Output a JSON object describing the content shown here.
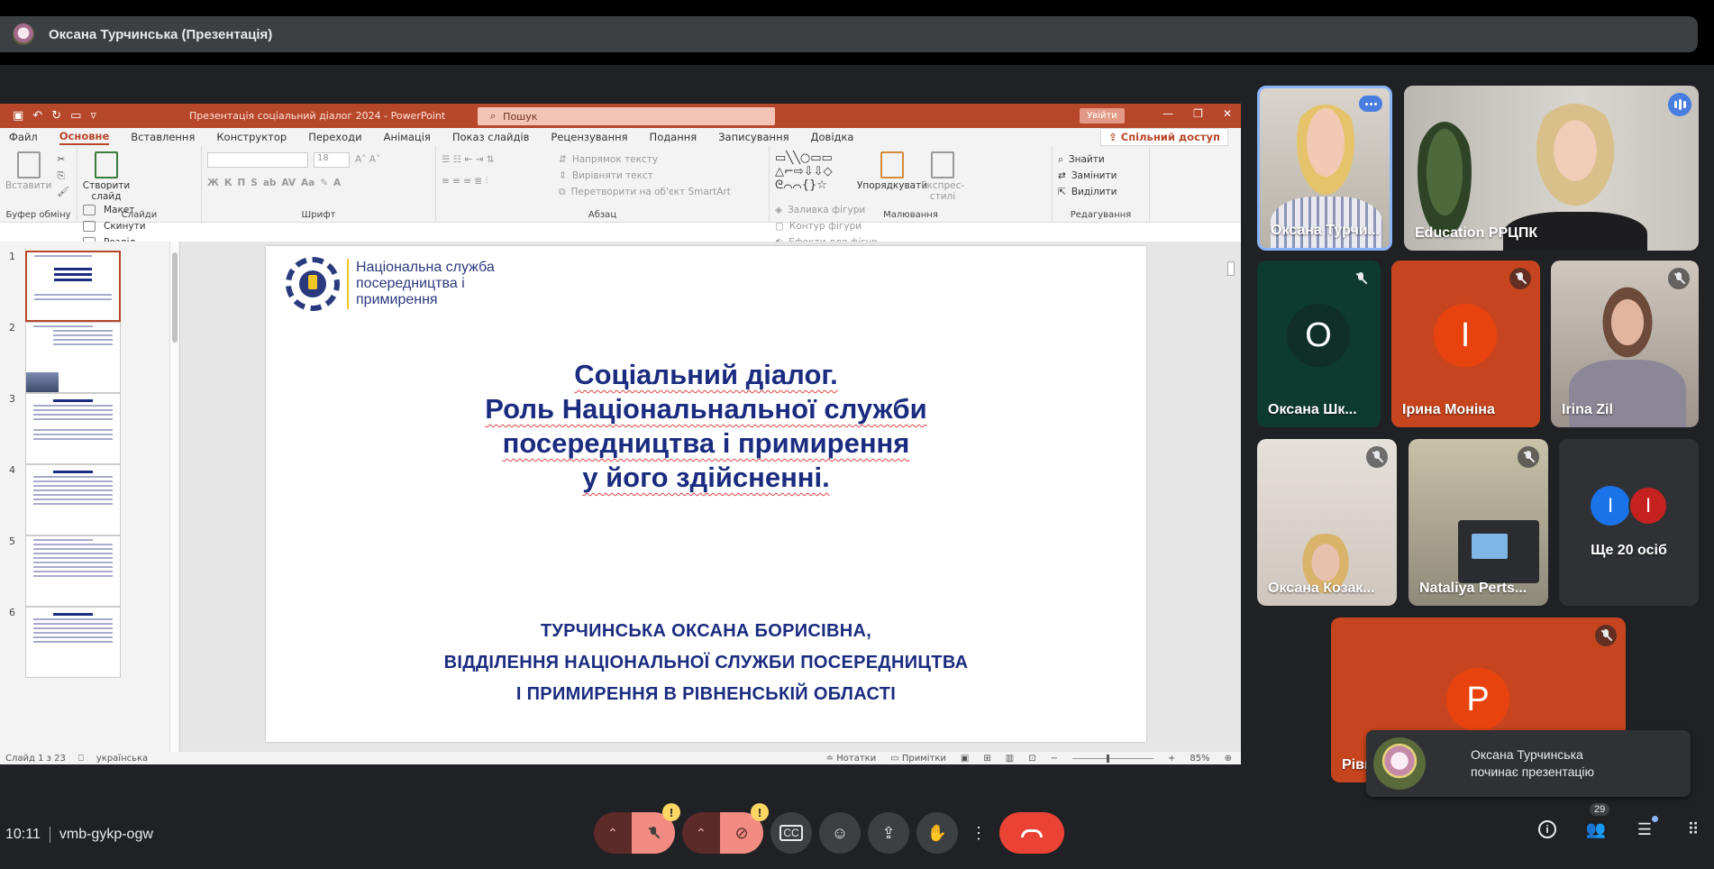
{
  "presenter": {
    "name": "Оксана Турчинська (Презентація)"
  },
  "ppt": {
    "doc_title": "Презентація соціальний діалог 2024  -  PowerPoint",
    "search_placeholder": "Пошук",
    "signin": "Увійти",
    "menu": [
      "Файл",
      "Основне",
      "Вставлення",
      "Конструктор",
      "Переходи",
      "Анімація",
      "Показ слайдів",
      "Рецензування",
      "Подання",
      "Записування",
      "Довідка"
    ],
    "share": "Спільний доступ",
    "ribbon": {
      "paste": "Вставити",
      "clipboard_group": "Буфер обміну",
      "new_slide": "Створити слайд",
      "layout": "Макет",
      "reset": "Скинути",
      "section": "Розділ",
      "slides_group": "Слайди",
      "font_size": "18",
      "font_group": "Шрифт",
      "text_direction": "Напрямок тексту",
      "align_text": "Вирівняти текст",
      "smartart": "Перетворити на об'єкт SmartArt",
      "paragraph_group": "Абзац",
      "arrange": "Упорядкувати",
      "quick_styles": "Експрес-стилі",
      "shape_fill": "Заливка фігури",
      "shape_outline": "Контур фігури",
      "shape_effects": "Ефекти для фігур",
      "drawing_group": "Малювання",
      "find": "Знайти",
      "replace": "Замінити",
      "select": "Виділити",
      "editing_group": "Редагування"
    },
    "thumbnails": [
      "1",
      "2",
      "3",
      "4",
      "5",
      "6"
    ],
    "slide": {
      "logo_line1": "Національна служба",
      "logo_line2": "посередництва і",
      "logo_line3": "примирення",
      "title_line1": "Соціальний діалог.",
      "title_line2": "Роль Національнальної служби",
      "title_line3": "посередництва і примирення",
      "title_line4": "у його здійсненні.",
      "sub_line1": "ТУРЧИНСЬКА ОКСАНА БОРИСІВНА,",
      "sub_line2": "ВІДДІЛЕННЯ НАЦІОНАЛЬНОЇ СЛУЖБИ ПОСЕРЕДНИЦТВА",
      "sub_line3": "І ПРИМИРЕННЯ  В РІВНЕНСЬКІЙ ОБЛАСТІ"
    },
    "status": {
      "slide_count": "Слайд 1 з 23",
      "language": "українська",
      "notes": "Нотатки",
      "comments": "Примітки",
      "zoom": "85%"
    }
  },
  "participants": {
    "p1": {
      "name": "Оксана Турчи..."
    },
    "p2": {
      "name": "Education РРЦПК"
    },
    "p3": {
      "name": "Оксана Шк...",
      "initial": "О"
    },
    "p4": {
      "name": "Ірина Моніна",
      "initial": "І"
    },
    "p5": {
      "name": "Irina Zil"
    },
    "p6": {
      "name": "Оксана Козак..."
    },
    "p7": {
      "name": "Nataliya Perts..."
    },
    "p8": {
      "label": "Ще 20 осіб",
      "initial_a": "I",
      "initial_b": "I"
    },
    "p9": {
      "name": "Рівн",
      "initial": "P"
    }
  },
  "toast": {
    "line1": "Оксана Турчинська",
    "line2": "починає презентацію"
  },
  "bottom": {
    "time": "10:11",
    "meeting_code": "vmb-gykp-ogw",
    "people_count": "29",
    "mic_warning": "!",
    "cam_warning": "!"
  },
  "colors": {
    "ppt_accent": "#b7472a",
    "slide_title": "#1b2c80",
    "end_call": "#ea4335",
    "tile_o": "#0d3b30",
    "tile_i": "#e8430f"
  }
}
